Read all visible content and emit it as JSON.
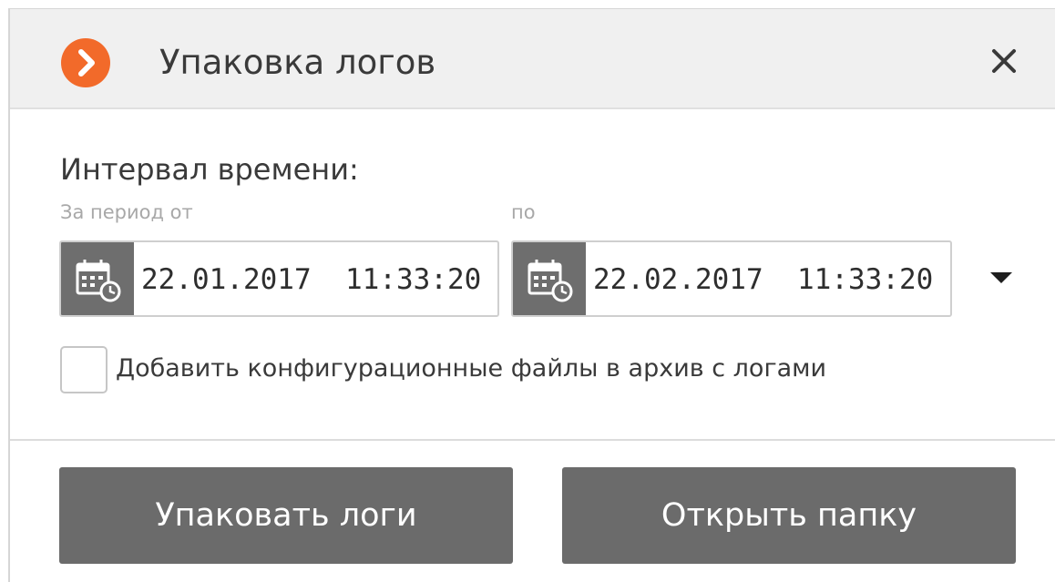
{
  "dialog": {
    "title": "Упаковка логов",
    "logo_icon": "chevron-right-circle-logo-icon",
    "close_icon": "close-icon",
    "accent_color": "#f26a2a"
  },
  "interval": {
    "heading": "Интервал времени:",
    "from_label": "За период от",
    "to_label": "по",
    "from_value": "22.01.2017  11:33:20",
    "to_value": "22.02.2017  11:33:20",
    "field_icon": "calendar-clock-icon",
    "dropdown_icon": "caret-down-icon"
  },
  "options": {
    "include_config_label": "Добавить конфигурационные файлы в архив с логами",
    "include_config_checked": false
  },
  "actions": {
    "pack_label": "Упаковать логи",
    "open_folder_label": "Открыть папку",
    "button_color": "#6b6b6b"
  }
}
